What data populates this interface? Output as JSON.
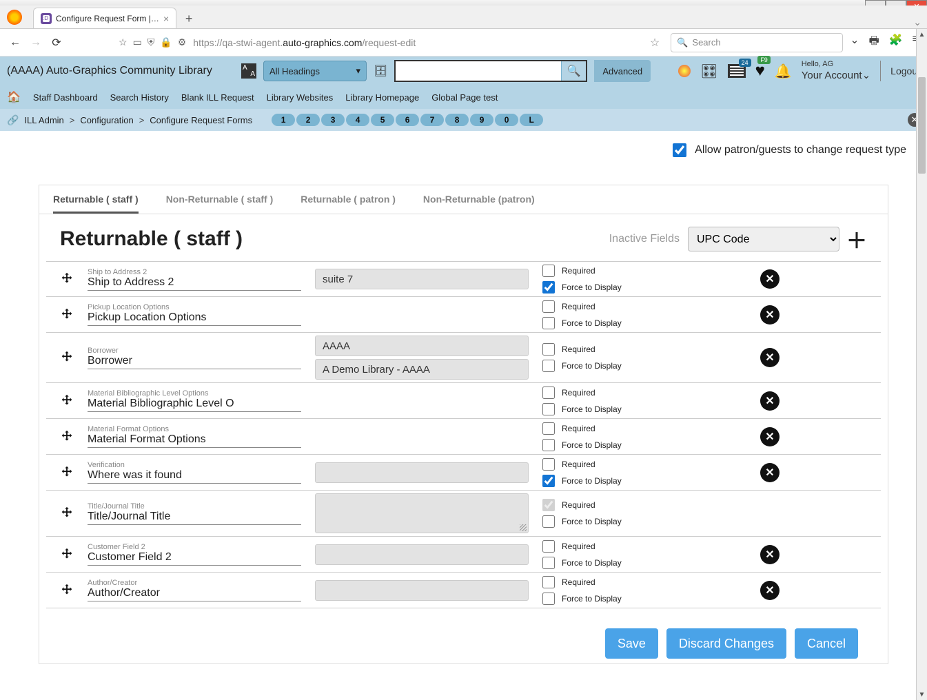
{
  "window": {
    "tab_title": "Configure Request Form | STWI",
    "url_pre": "https://qa-stwi-agent.",
    "url_domain": "auto-graphics.com",
    "url_path": "/request-edit",
    "search_placeholder": "Search"
  },
  "header": {
    "libname": "(AAAA) Auto-Graphics Community Library",
    "headings": "All Headings",
    "advanced": "Advanced",
    "list_badge": "24",
    "fav_badge": "F9",
    "hello": "Hello, AG",
    "account": "Your Account",
    "logout": "Logout"
  },
  "nav": {
    "items": [
      "Staff Dashboard",
      "Search History",
      "Blank ILL Request",
      "Library Websites",
      "Library Homepage",
      "Global Page test"
    ]
  },
  "crumbs": {
    "a": "ILL Admin",
    "b": "Configuration",
    "c": "Configure Request Forms",
    "pills": [
      "1",
      "2",
      "3",
      "4",
      "5",
      "6",
      "7",
      "8",
      "9",
      "0",
      "L"
    ]
  },
  "allow": {
    "label": "Allow patron/guests to change request type",
    "checked": true
  },
  "formtabs": [
    "Returnable ( staff )",
    "Non-Returnable ( staff )",
    "Returnable ( patron )",
    "Non-Returnable (patron)"
  ],
  "formhead": {
    "title": "Returnable ( staff )",
    "inactive_label": "Inactive Fields",
    "select": "UPC Code"
  },
  "col_labels": {
    "required": "Required",
    "force": "Force to Display"
  },
  "fields": [
    {
      "small": "Ship to Address 2",
      "big": "Ship to Address 2",
      "vals": [
        "suite 7"
      ],
      "req": false,
      "force": true,
      "del": true
    },
    {
      "small": "Pickup Location Options",
      "big": "Pickup Location Options",
      "vals": [],
      "req": false,
      "force": false,
      "del": true
    },
    {
      "small": "Borrower",
      "big": "Borrower",
      "vals": [
        "AAAA",
        "A Demo Library - AAAA"
      ],
      "req": false,
      "force": false,
      "del": true
    },
    {
      "small": "Material Bibliographic Level Options",
      "big": "Material Bibliographic Level O",
      "vals": [],
      "req": false,
      "force": false,
      "del": true
    },
    {
      "small": "Material Format Options",
      "big": "Material Format Options",
      "vals": [],
      "req": false,
      "force": false,
      "del": true
    },
    {
      "small": "Verification",
      "big": "Where was it found",
      "vals": [
        ""
      ],
      "tall": false,
      "req": false,
      "force": true,
      "del": true
    },
    {
      "small": "Title/Journal Title",
      "big": "Title/Journal Title",
      "vals": [
        ""
      ],
      "tall": true,
      "req": true,
      "req_grey": true,
      "force": false,
      "del": false
    },
    {
      "small": "Customer Field 2",
      "big": "Customer Field 2",
      "vals": [
        ""
      ],
      "req": false,
      "force": false,
      "del": true
    },
    {
      "small": "Author/Creator",
      "big": "Author/Creator",
      "vals": [
        ""
      ],
      "req": false,
      "force": false,
      "del": true
    }
  ],
  "actions": {
    "save": "Save",
    "discard": "Discard Changes",
    "cancel": "Cancel"
  }
}
